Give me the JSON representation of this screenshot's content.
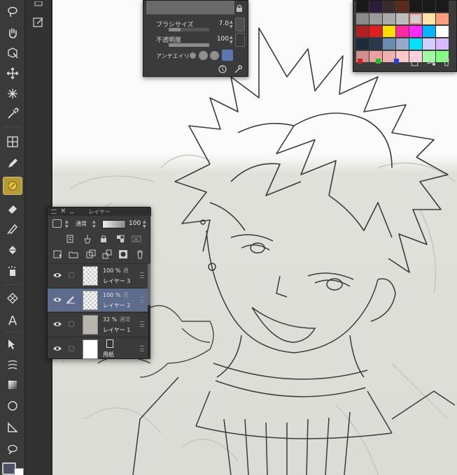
{
  "toolbar": {
    "tools": [
      {
        "name": "lasso-tool"
      },
      {
        "name": "hand-tool"
      },
      {
        "name": "object-select-tool"
      },
      {
        "name": "move-tool"
      },
      {
        "name": "auto-select-tool"
      },
      {
        "name": "eyedropper-tool"
      },
      {
        "name": "frame-tool"
      },
      {
        "name": "pen-tool"
      },
      {
        "name": "brush-tool",
        "active": true
      },
      {
        "name": "eraser-tool"
      },
      {
        "name": "blend-tool"
      },
      {
        "name": "fill-tool"
      },
      {
        "name": "airbrush-tool"
      },
      {
        "name": "decoration-tool"
      },
      {
        "name": "text-tool",
        "glyph": "A"
      },
      {
        "name": "operation-tool"
      },
      {
        "name": "ruler-tool"
      },
      {
        "name": "gradient-tool"
      },
      {
        "name": "figure-tool"
      },
      {
        "name": "perspective-tool"
      },
      {
        "name": "balloon-tool"
      }
    ],
    "main_color": "#4c5066",
    "sub_color": "#ffffff"
  },
  "brush_panel": {
    "size_label": "ブラシサイズ",
    "size_value": "7.0",
    "size_fraction": 0.3,
    "opacity_label": "不透明度",
    "opacity_value": "100",
    "opacity_fraction": 1.0,
    "antialias_label": "アンチエイリ",
    "antialias_level": 4
  },
  "palette": {
    "colors": [
      "#1a1a1a",
      "#2e1a3a",
      "#3a2a2a",
      "#5a2a1a",
      "#1a1a1a",
      "#1a1a1a",
      "#1a1a1a",
      "#8a8a8a",
      "#9a9a9a",
      "#aaaaaa",
      "#bdbdbd",
      "#cfcfcf",
      "#ffe3a8",
      "#ff9e7a",
      "#b02020",
      "#e02020",
      "#ffde00",
      "#ff2aa0",
      "#ff2aff",
      "#00b4ff",
      "#ffffff",
      "#1c2a3a",
      "#2a3a4a",
      "#6a8ab0",
      "#9aa8c8",
      "#00e0ff",
      "#d0d0ff",
      "#d8b8ff",
      "#d09090",
      "#e8a0a0",
      "#f0b0b0",
      "#ffc8c8",
      "#ffd0e0",
      "#a0ffa0",
      "#80ff80"
    ],
    "selected_index": 11,
    "foot_dots": [
      "#d02020",
      "#20c020",
      "#2040e0"
    ]
  },
  "layer_panel": {
    "title": "レイヤー",
    "blend_mode": "通常",
    "opacity": "100",
    "layers": [
      {
        "opacity": "100 %",
        "mode": "通",
        "name": "レイヤー 3",
        "thumb": "transparent",
        "selected": false
      },
      {
        "opacity": "100 %",
        "mode": "通",
        "name": "レイヤー 2",
        "thumb": "transparent",
        "selected": true
      },
      {
        "opacity": "32 %",
        "mode": "通常",
        "name": "レイヤー 1",
        "thumb": "sketch",
        "selected": false
      },
      {
        "opacity": "",
        "mode": "",
        "name": "用紙",
        "thumb": "white",
        "selected": false
      }
    ]
  }
}
